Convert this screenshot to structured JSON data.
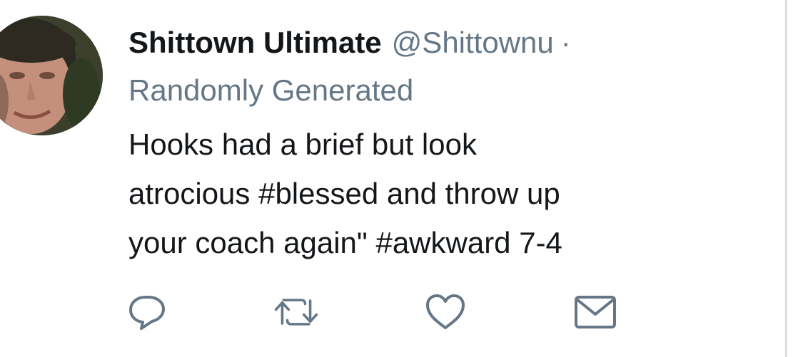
{
  "tweet": {
    "display_name": "Shittown Ultimate",
    "handle": "@Shittownu",
    "separator": "·",
    "subtitle": "Randomly Generated",
    "body_lines": [
      "Hooks had a brief but look",
      "atrocious #blessed and throw up",
      "your coach again\" #awkward 7-4"
    ]
  },
  "actions": {
    "reply_icon": "reply-icon",
    "retweet_icon": "retweet-icon",
    "like_icon": "heart-icon",
    "dm_icon": "envelope-icon"
  },
  "colors": {
    "text": "#14171a",
    "secondary": "#657786",
    "icon": "#657786",
    "divider": "#d9dde0"
  }
}
